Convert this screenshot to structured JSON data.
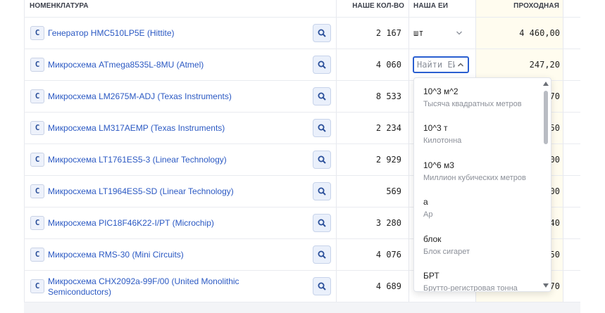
{
  "header": {
    "col_nomenclature": "НОМЕНКЛАТУРА",
    "col_our_qty": "НАШЕ КОЛ-ВО",
    "col_our_unit": "НАША ЕИ",
    "col_pass": "ПРОХОДНАЯ"
  },
  "rows": [
    {
      "badge": "C",
      "name": "Генератор HMC510LP5E (Hittite)",
      "qty": "2 167",
      "unit": "шт",
      "price": "4 460,00"
    },
    {
      "badge": "C",
      "name": "Микросхема ATmega8535L-8MU (Atmel)",
      "qty": "4 060",
      "unit": "",
      "price": "247,20"
    },
    {
      "badge": "C",
      "name": "Микросхема LM2675M-ADJ (Texas Instruments)",
      "qty": "8 533",
      "unit": "",
      "price": "70"
    },
    {
      "badge": "C",
      "name": "Микросхема LM317AEMP (Texas Instruments)",
      "qty": "2 234",
      "unit": "",
      "price": "50"
    },
    {
      "badge": "C",
      "name": "Микросхема LT1761ES5-3 (Linear Technology)",
      "qty": "2 929",
      "unit": "",
      "price": "00"
    },
    {
      "badge": "C",
      "name": "Микросхема LT1964ES5-SD (Linear Technology)",
      "qty": "569",
      "unit": "",
      "price": "00"
    },
    {
      "badge": "C",
      "name": "Микросхема PIC18F46K22-I/PT (Microchip)",
      "qty": "3 280",
      "unit": "",
      "price": "40"
    },
    {
      "badge": "C",
      "name": "Микросхема RMS-30 (Mini Circuits)",
      "qty": "4 076",
      "unit": "",
      "price": "50"
    },
    {
      "badge": "C",
      "name_line1": "Микросхема CHX2092a-99F/00 (United Monolithic",
      "name_line2": "Semiconductors)",
      "qty": "4 689",
      "unit": "",
      "price": "70"
    }
  ],
  "unit_input": {
    "placeholder": "Найти ЕИ"
  },
  "dropdown_options": [
    {
      "code": "10^3 м^2",
      "desc": "Тысяча квадратных метров"
    },
    {
      "code": "10^3 т",
      "desc": "Килотонна"
    },
    {
      "code": "10^6 м3",
      "desc": "Миллион кубических метров"
    },
    {
      "code": "а",
      "desc": "Ар"
    },
    {
      "code": "блок",
      "desc": "Блок сигарет"
    },
    {
      "code": "БРТ",
      "desc": "Брутто-регистровая тонна"
    }
  ],
  "icons": {
    "search": "search-icon",
    "chevron": "chevron-down-icon",
    "chevron_up": "chevron-up-icon"
  },
  "colors": {
    "link": "#2b59c3",
    "accent": "#2a5fd0",
    "yellow_col": "#fffcef"
  }
}
